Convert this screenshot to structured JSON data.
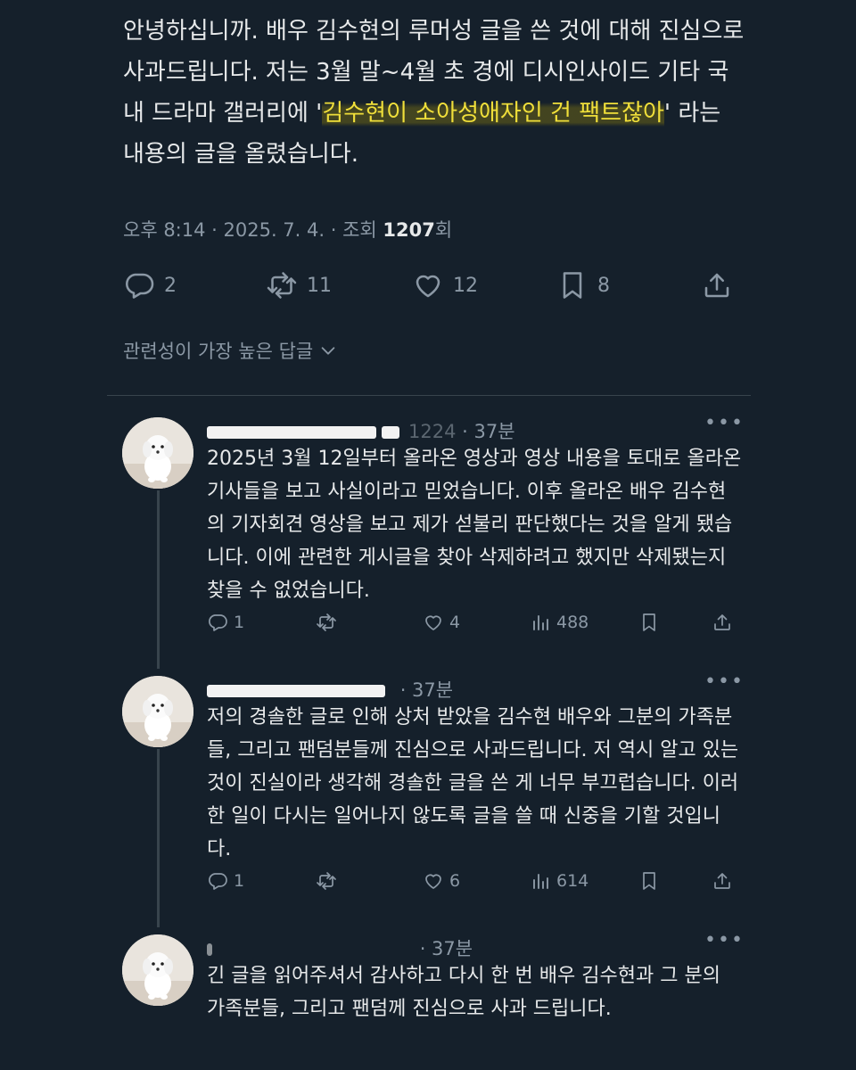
{
  "post": {
    "text_before": "안녕하십니까. 배우 김수현의 루머성 글을 쓴 것에 대해 진심으로 사과드립니다. 저는 3월 말~4월 초 경에 디시인사이드 기타 국내 드라마 갤러리에 '",
    "text_highlight": "김수현이 소아성애자인 건 팩트잖아",
    "text_after": "' 라는 내용의 글을 올렸습니다.",
    "meta_prefix": "오후 8:14 · 2025. 7. 4. · 조회 ",
    "views": "1207",
    "views_suffix": "회",
    "actions": {
      "replies": "2",
      "reposts": "11",
      "likes": "12",
      "bookmarks": "8"
    }
  },
  "sort_label": "관련성이 가장 높은 답글",
  "replies": [
    {
      "handle_visible": "1224",
      "time": "· 37분",
      "text": "2025년 3월 12일부터 올라온 영상과 영상 내용을 토대로 올라온 기사들을 보고 사실이라고 믿었습니다. 이후 올라온 배우 김수현의 기자회견 영상을 보고 제가 섣불리 판단했다는 것을 알게 됐습니다. 이에 관련한 게시글을 찾아 삭제하려고 했지만 삭제됐는지 찾을 수 없었습니다.",
      "stats": {
        "replies": "1",
        "reposts": "",
        "likes": "4",
        "views": "488"
      }
    },
    {
      "handle_visible": "",
      "time": "· 37분",
      "text": "저의 경솔한 글로 인해 상처 받았을 김수현 배우와 그분의 가족분들, 그리고 팬덤분들께 진심으로 사과드립니다. 저 역시 알고 있는 것이 진실이라 생각해 경솔한 글을 쓴 게 너무 부끄럽습니다. 이러한 일이 다시는 일어나지 않도록 글을 쓸 때 신중을 기할 것입니다.",
      "stats": {
        "replies": "1",
        "reposts": "",
        "likes": "6",
        "views": "614"
      }
    },
    {
      "handle_visible": "",
      "time": "· 37분",
      "text": "긴 글을 읽어주셔서 감사하고 다시 한 번 배우 김수현과 그 분의 가족분들, 그리고 팬덤께 진심으로 사과 드립니다.",
      "stats": {}
    }
  ],
  "icons": {
    "reply": "speech-bubble-icon",
    "repost": "repost-arrows-icon",
    "like": "heart-icon",
    "bookmark": "bookmark-icon",
    "share": "share-upload-icon",
    "views": "bar-chart-icon",
    "more": "more-dots-icon",
    "chevron": "chevron-down-icon",
    "avatar": "white-puppy-avatar"
  },
  "colors": {
    "background": "#15202b",
    "text": "#e7e9ea",
    "secondary": "#8b98a5",
    "highlight": "#f0df3a",
    "divider": "#38444d"
  }
}
